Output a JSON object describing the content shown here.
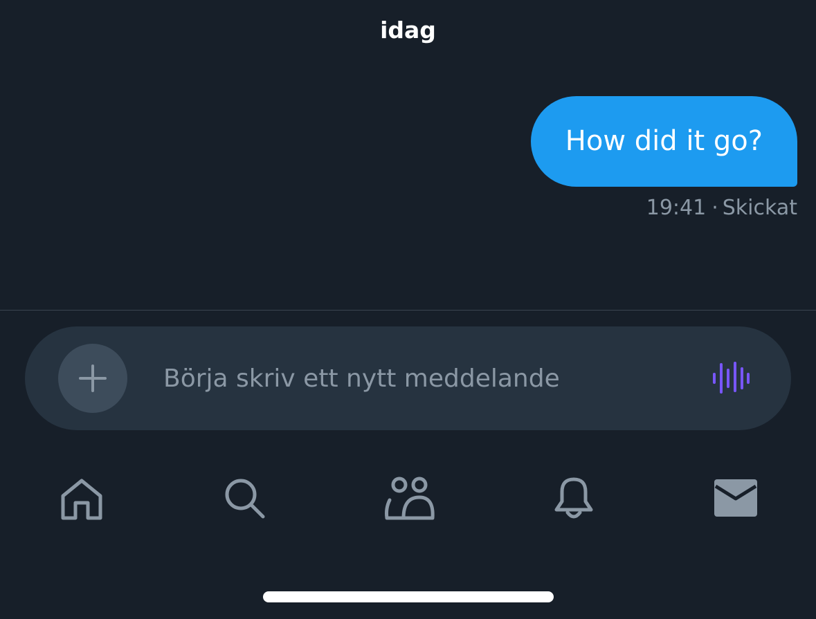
{
  "conversation": {
    "date_label": "idag",
    "messages": [
      {
        "text": "How did it go?",
        "time": "19:41",
        "separator": "·",
        "status": "Skickat"
      }
    ]
  },
  "composer": {
    "placeholder": "Börja skriv ett nytt meddelande",
    "add_icon": "plus-icon",
    "voice_icon": "audio-waveform-icon",
    "voice_color": "#7856ff"
  },
  "tabbar": {
    "items": [
      {
        "name": "home",
        "icon": "home-icon"
      },
      {
        "name": "search",
        "icon": "search-icon"
      },
      {
        "name": "communities",
        "icon": "people-icon"
      },
      {
        "name": "notifications",
        "icon": "bell-icon"
      },
      {
        "name": "messages",
        "icon": "mail-icon",
        "active": true
      }
    ]
  },
  "colors": {
    "background": "#171f29",
    "bubble": "#1d9bf0",
    "composer": "#263340",
    "muted": "#8b98a5"
  }
}
